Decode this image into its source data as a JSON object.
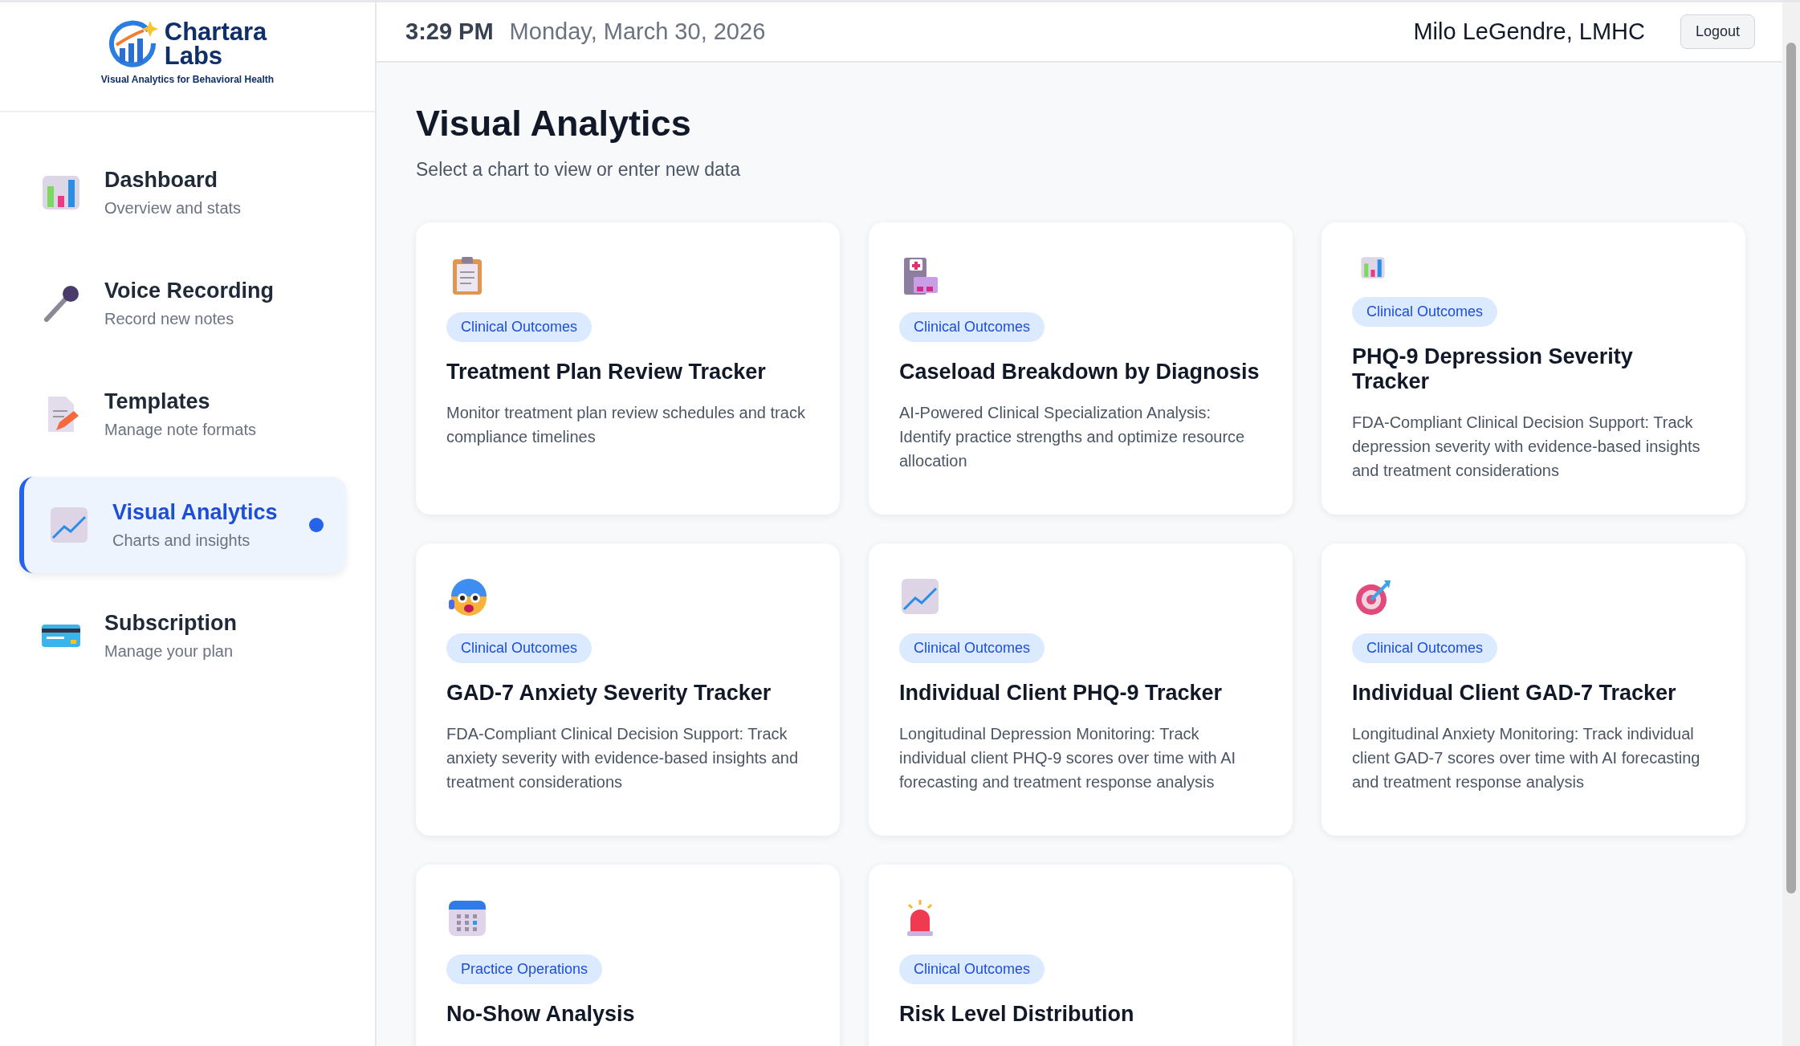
{
  "brand": {
    "name_line1": "Chartara",
    "name_line2": "Labs",
    "tagline": "Visual Analytics for Behavioral Health"
  },
  "sidebar": {
    "items": [
      {
        "title": "Dashboard",
        "subtitle": "Overview and stats",
        "selected": false
      },
      {
        "title": "Voice Recording",
        "subtitle": "Record new notes",
        "selected": false
      },
      {
        "title": "Templates",
        "subtitle": "Manage note formats",
        "selected": false
      },
      {
        "title": "Visual Analytics",
        "subtitle": "Charts and insights",
        "selected": true
      },
      {
        "title": "Subscription",
        "subtitle": "Manage your plan",
        "selected": false
      }
    ]
  },
  "topbar": {
    "time": "3:29 PM",
    "date": "Monday, March 30, 2026",
    "user": "Milo LeGendre, LMHC",
    "logout": "Logout"
  },
  "page": {
    "title": "Visual Analytics",
    "subtitle": "Select a chart to view or enter new data"
  },
  "cards": [
    {
      "tag": "Clinical Outcomes",
      "title": "Treatment Plan Review Tracker",
      "description": "Monitor treatment plan review schedules and track compliance timelines"
    },
    {
      "tag": "Clinical Outcomes",
      "title": "Caseload Breakdown by Diagnosis",
      "description": "AI-Powered Clinical Specialization Analysis: Identify practice strengths and optimize resource allocation"
    },
    {
      "tag": "Clinical Outcomes",
      "title": "PHQ-9 Depression Severity Tracker",
      "description": "FDA-Compliant Clinical Decision Support: Track depression severity with evidence-based insights and treatment considerations"
    },
    {
      "tag": "Clinical Outcomes",
      "title": "GAD-7 Anxiety Severity Tracker",
      "description": "FDA-Compliant Clinical Decision Support: Track anxiety severity with evidence-based insights and treatment considerations"
    },
    {
      "tag": "Clinical Outcomes",
      "title": "Individual Client PHQ-9 Tracker",
      "description": "Longitudinal Depression Monitoring: Track individual client PHQ-9 scores over time with AI forecasting and treatment response analysis"
    },
    {
      "tag": "Clinical Outcomes",
      "title": "Individual Client GAD-7 Tracker",
      "description": "Longitudinal Anxiety Monitoring: Track individual client GAD-7 scores over time with AI forecasting and treatment response analysis"
    },
    {
      "tag": "Practice Operations",
      "title": "No-Show Analysis"
    },
    {
      "tag": "Clinical Outcomes",
      "title": "Risk Level Distribution"
    }
  ]
}
